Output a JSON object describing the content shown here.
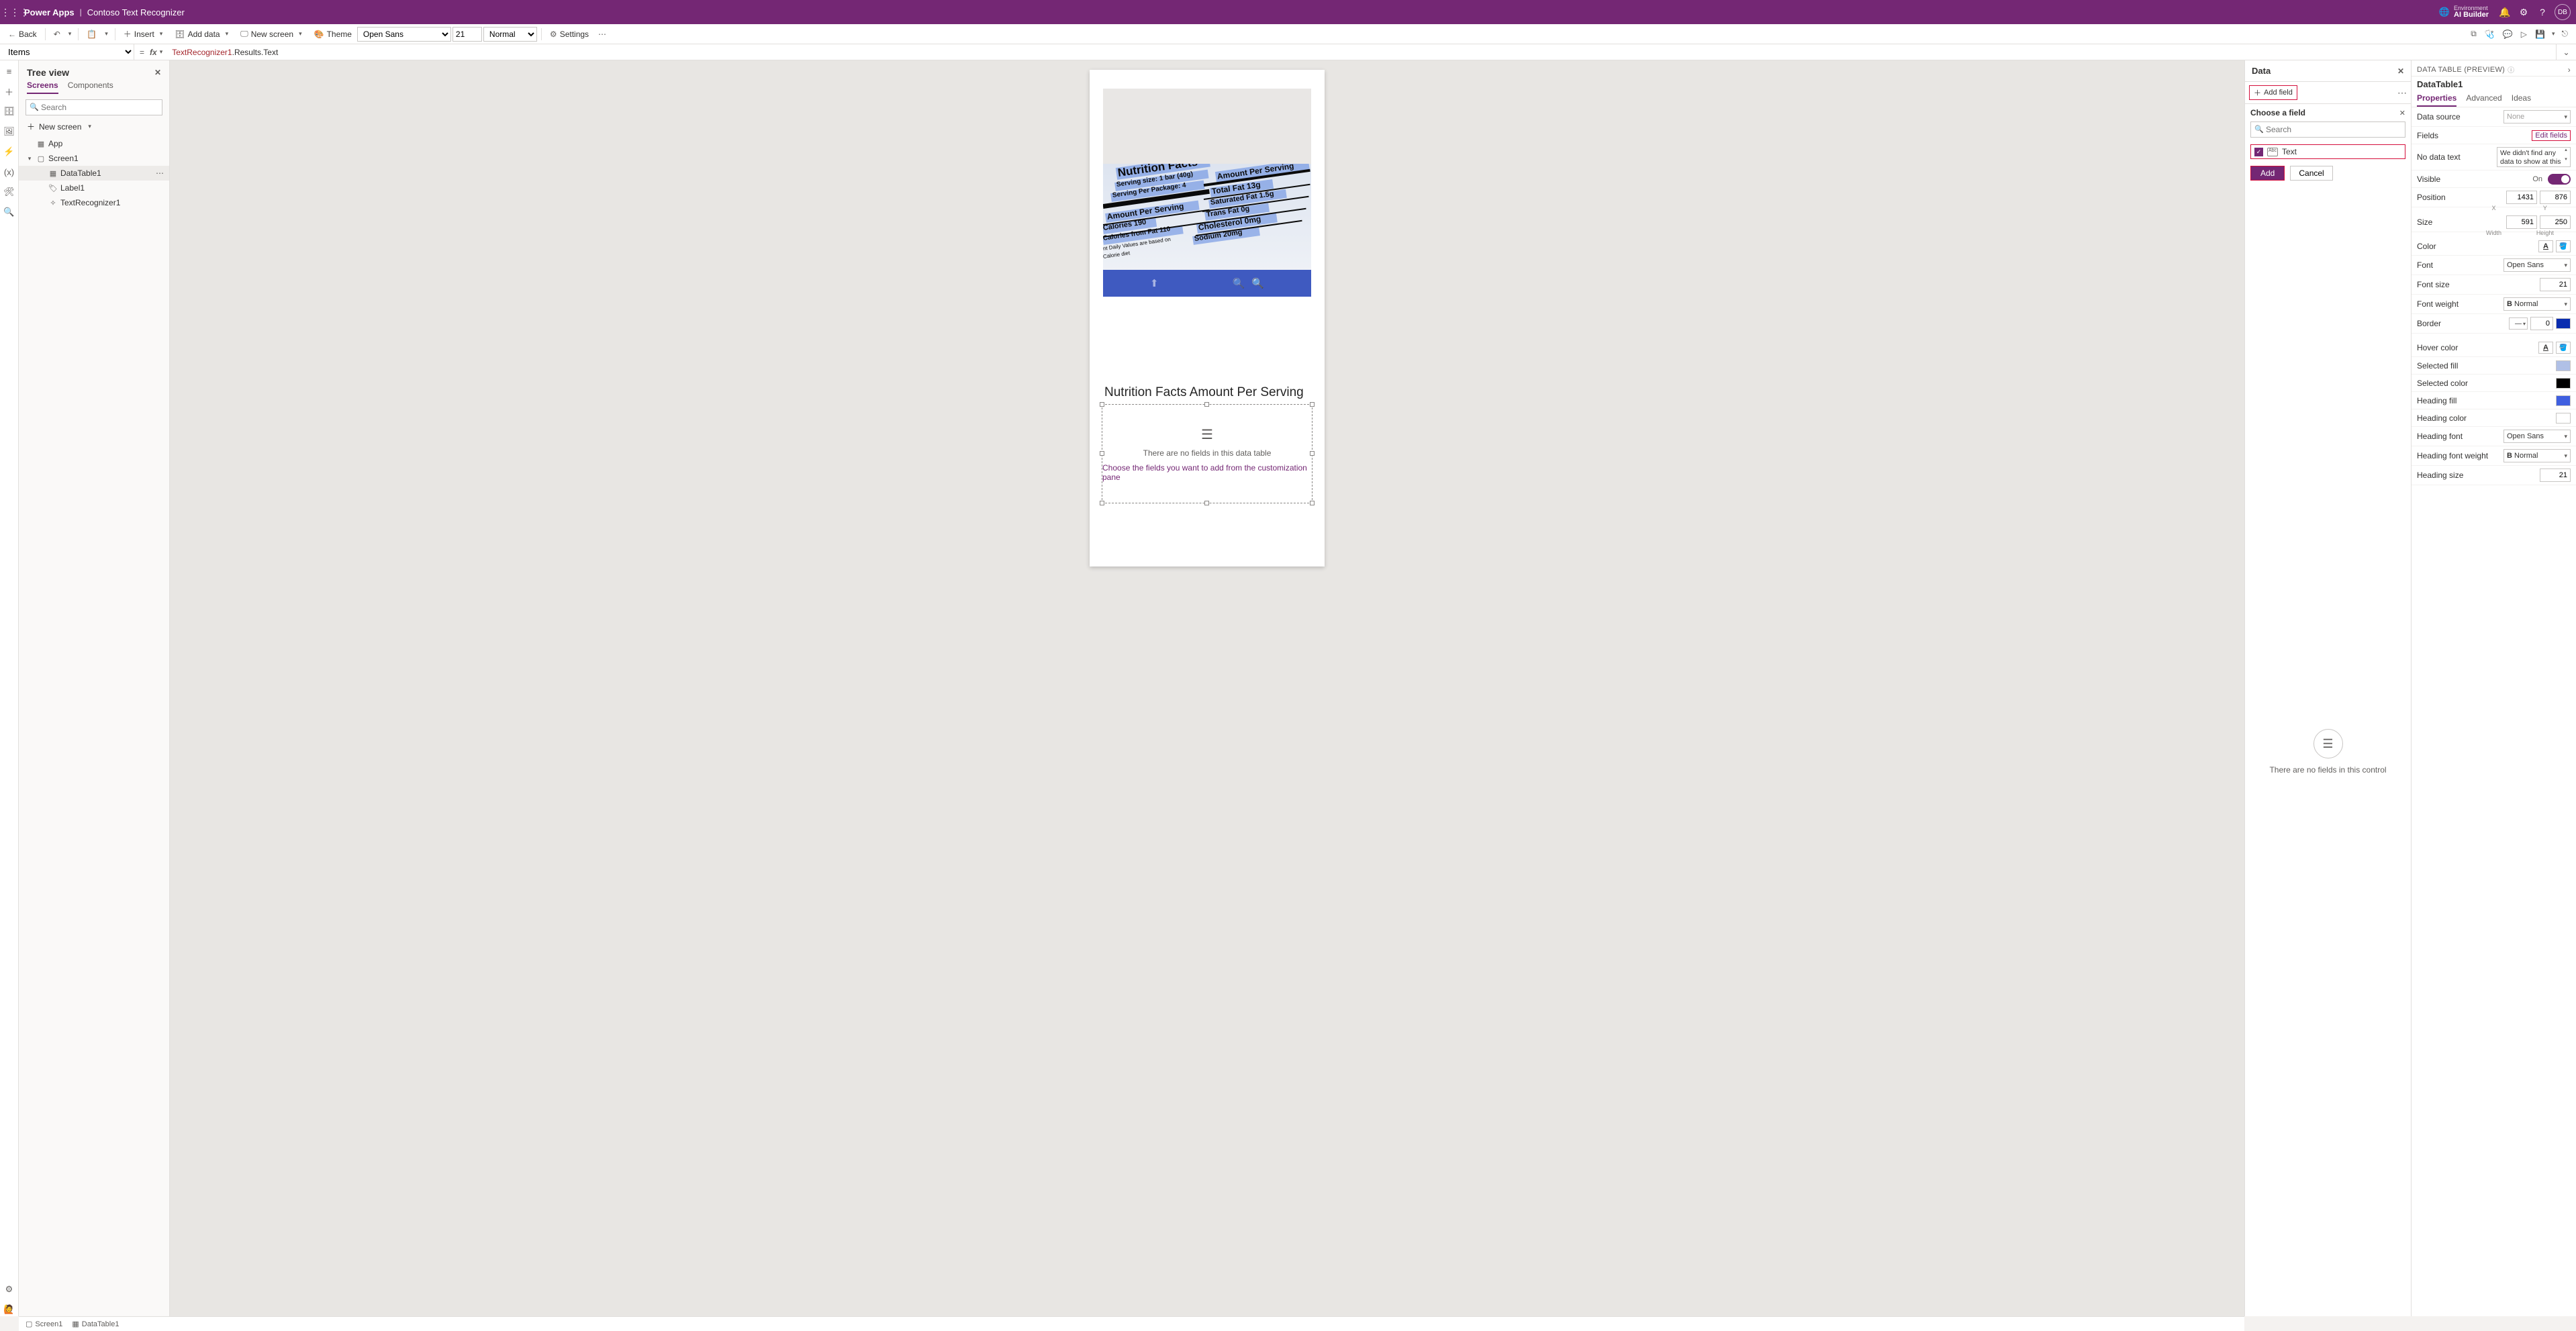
{
  "header": {
    "brand": "Power Apps",
    "app_name": "Contoso Text Recognizer",
    "env_label": "Environment",
    "env_value": "AI Builder",
    "persona": "DB"
  },
  "cmdbar": {
    "back": "Back",
    "insert": "Insert",
    "add_data": "Add data",
    "new_screen": "New screen",
    "theme": "Theme",
    "font_name": "Open Sans",
    "font_size": "21",
    "font_weight": "Normal",
    "settings": "Settings"
  },
  "formula": {
    "property": "Items",
    "token_red": "TextRecognizer1",
    "token_rest": ".Results.Text"
  },
  "tree": {
    "title": "Tree view",
    "tab_screens": "Screens",
    "tab_components": "Components",
    "search_placeholder": "Search",
    "new_screen": "New screen",
    "app": "App",
    "screen1": "Screen1",
    "datatable1": "DataTable1",
    "label1": "Label1",
    "textrecognizer1": "TextRecognizer1"
  },
  "canvas": {
    "label_text": "Nutrition Facts Amount Per Serving",
    "dt_empty1": "There are no fields in this data table",
    "dt_empty2": "Choose the fields you want to add from the customization pane",
    "nutrition_texts": [
      "Nutrition Facts",
      "Serving size: 1 bar (40g)",
      "Serving Per Package: 4",
      "Amount Per Serving",
      "Calories 190",
      "Calories from Fat 110",
      "nt Daily Values are based on",
      "Calorie diet",
      "Amount Per Serving",
      "Total Fat 13g",
      "Saturated Fat 1.5g",
      "Trans Fat 0g",
      "Cholesterol 0mg",
      "Sodium 20mg"
    ]
  },
  "data_panel": {
    "title": "Data",
    "add_field": "Add field",
    "choose": "Choose a field",
    "search_placeholder": "Search",
    "field_text": "Text",
    "add": "Add",
    "cancel": "Cancel",
    "nofields": "There are no fields in this control"
  },
  "props": {
    "hdr": "DATA TABLE (PREVIEW)",
    "obj": "DataTable1",
    "tab_properties": "Properties",
    "tab_advanced": "Advanced",
    "tab_ideas": "Ideas",
    "data_source": "Data source",
    "data_source_val": "None",
    "fields": "Fields",
    "edit_fields": "Edit fields",
    "no_data_text": "No data text",
    "no_data_text_val": "We didn't find any data to show at this",
    "visible": "Visible",
    "visible_val": "On",
    "position": "Position",
    "pos_x": "1431",
    "pos_y": "876",
    "pos_xl": "X",
    "pos_yl": "Y",
    "size": "Size",
    "size_w": "591",
    "size_h": "250",
    "size_wl": "Width",
    "size_hl": "Height",
    "color": "Color",
    "font": "Font",
    "font_val": "Open Sans",
    "font_size": "Font size",
    "font_size_val": "21",
    "font_weight": "Font weight",
    "font_weight_val": "Normal",
    "border": "Border",
    "border_val": "0",
    "hover_color": "Hover color",
    "selected_fill": "Selected fill",
    "selected_color": "Selected color",
    "heading_fill": "Heading fill",
    "heading_color": "Heading color",
    "heading_font": "Heading font",
    "heading_font_val": "Open Sans",
    "heading_font_weight": "Heading font weight",
    "heading_font_weight_val": "Normal",
    "heading_size": "Heading size",
    "heading_size_val": "21"
  },
  "statusbar": {
    "screen1": "Screen1",
    "datatable1": "DataTable1"
  },
  "colors": {
    "selected_fill": "#b0c0e6",
    "selected_color": "#000000",
    "heading_fill": "#3f5fe0",
    "heading_color": "#ffffff",
    "border_color": "#0a2db0"
  }
}
